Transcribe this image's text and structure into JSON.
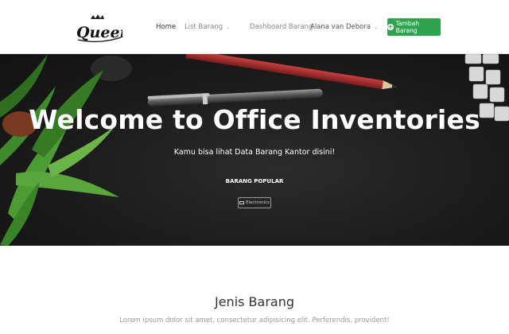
{
  "brand": {
    "name": "Queen"
  },
  "nav": {
    "home": "Home",
    "list_barang": "List Barang",
    "dashboard": "Dashboard Barang",
    "user": "Alana van Debora",
    "add_button": "Tambah Barang"
  },
  "hero": {
    "title": "Welcome to Office Inventories",
    "subtitle": "Kamu bisa lihat Data Barang Kantor disini!",
    "popular_label": "BARANG POPULAR",
    "tag": "Electronics"
  },
  "section": {
    "title": "Jenis Barang",
    "description": "Lorem ipsum dolor sit amet, consectetur adipisicing elit. Perferendis, provident!"
  },
  "colors": {
    "accent": "#2ea44f",
    "hero_bg": "#1b1b1b"
  }
}
